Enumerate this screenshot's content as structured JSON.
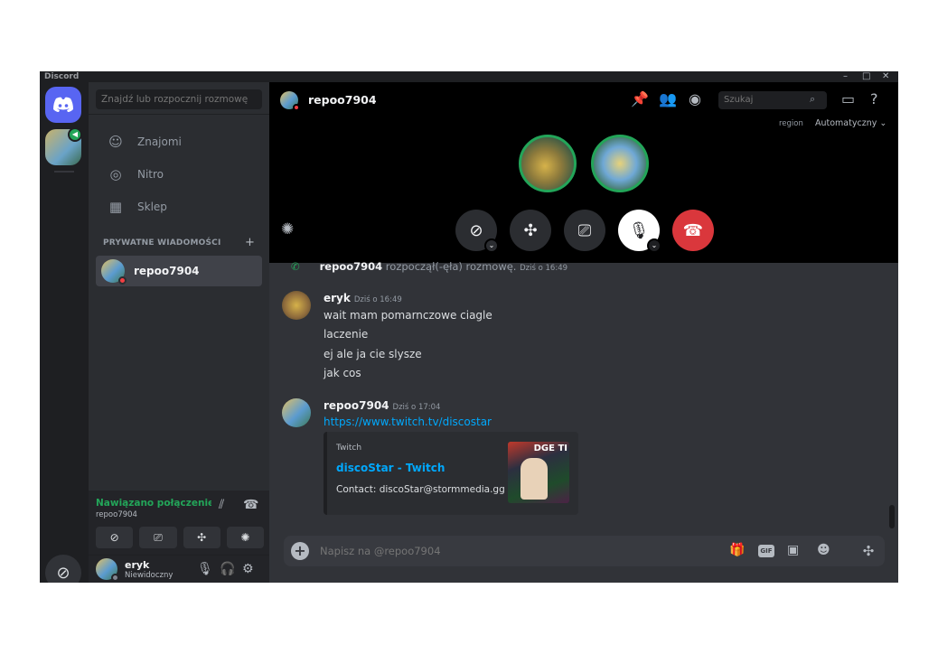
{
  "window": {
    "app_title": "Discord",
    "controls": [
      "–",
      "□",
      "✕"
    ]
  },
  "guilds": {
    "home_icon": "discord-logo-icon",
    "discover_icon": "compass-icon"
  },
  "dm_sidebar": {
    "search_placeholder": "Znajdź lub rozpocznij rozmowę",
    "nav": [
      {
        "label": "Znajomi",
        "icon": "friends-icon"
      },
      {
        "label": "Nitro",
        "icon": "nitro-icon"
      },
      {
        "label": "Sklep",
        "icon": "shop-icon"
      }
    ],
    "dm_header": "PRYWATNE WIADOMOŚCI",
    "dm_add": "+",
    "dm_items": [
      {
        "name": "repoo7904",
        "status": "dnd"
      }
    ]
  },
  "voice_panel": {
    "status": "Nawiązano połączenie",
    "channel": "repoo7904"
  },
  "user_panel": {
    "name": "eryk",
    "status": "Niewidoczny"
  },
  "topbar": {
    "title": "repoo7904",
    "search_placeholder": "Szukaj",
    "region_label": "region",
    "region_value": "Automatyczny ⌄"
  },
  "call": {
    "buttons": [
      "camera-off-icon",
      "activities-icon",
      "screenshare-icon",
      "microphone-icon",
      "hang-up-icon"
    ]
  },
  "chat": {
    "system": {
      "who": "repoo7904",
      "text": " rozpoczął(-ęła) rozmowę.",
      "time": "Dziś o 16:49"
    },
    "messages": [
      {
        "author": "eryk",
        "time": "Dziś o 16:49",
        "lines": [
          "wait mam pomarnczowe ciagle",
          "laczenie",
          "ej ale ja cie slysze",
          "jak cos"
        ]
      },
      {
        "author": "repoo7904",
        "time": "Dziś o 17:04",
        "link": "https://www.twitch.tv/discostar",
        "embed": {
          "provider": "Twitch",
          "title": "discoStar - Twitch",
          "description": "Contact: discoStar@stormmedia.gg",
          "thumb_text": "DGE TI"
        }
      }
    ]
  },
  "composer": {
    "placeholder": "Napisz na @repoo7904",
    "gif_label": "GIF"
  }
}
